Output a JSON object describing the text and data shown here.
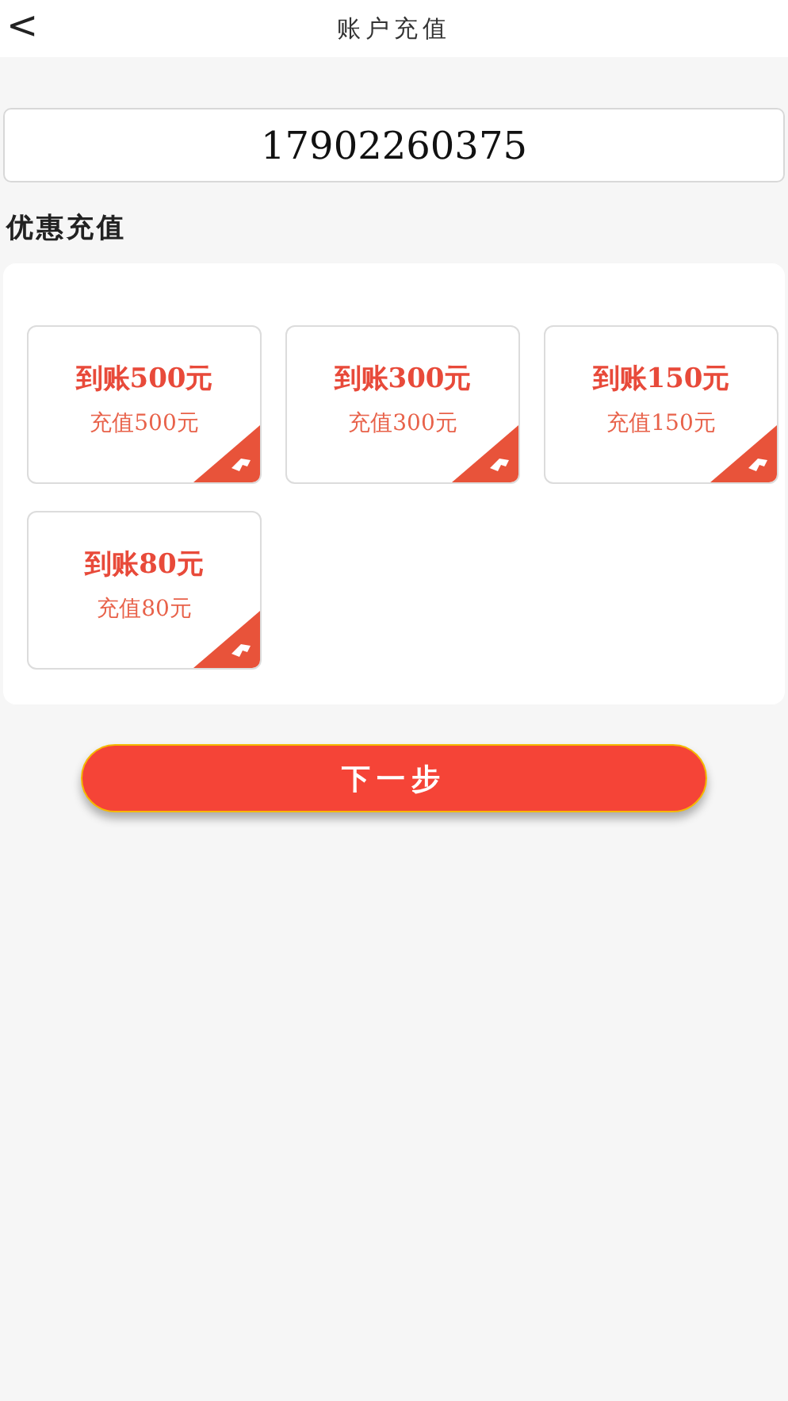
{
  "header": {
    "back": "<",
    "title": "账户充值"
  },
  "account": {
    "value": "17902260375"
  },
  "section_title": "优惠充值",
  "options": [
    {
      "credit": "到账500元",
      "price": "充值500元"
    },
    {
      "credit": "到账300元",
      "price": "充值300元"
    },
    {
      "credit": "到账150元",
      "price": "充值150元"
    },
    {
      "credit": "到账80元",
      "price": "充值80元"
    }
  ],
  "next_button": "下一步"
}
